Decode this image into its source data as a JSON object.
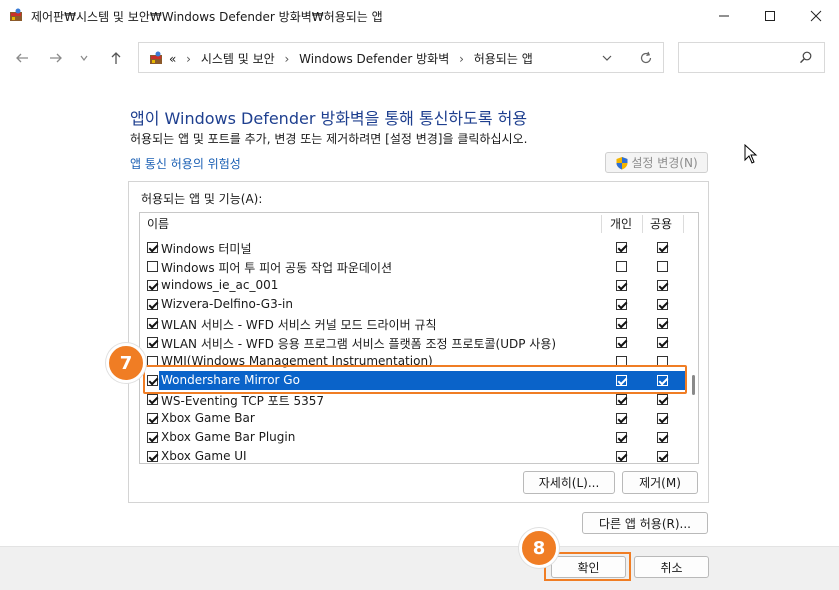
{
  "window": {
    "title": "제어판₩시스템 및 보안₩Windows Defender 방화벽₩허용되는 앱",
    "minimize_icon": "minimize-icon",
    "maximize_icon": "maximize-icon",
    "close_icon": "close-icon"
  },
  "navigation": {
    "back_icon": "arrow-left-icon",
    "forward_icon": "arrow-right-icon",
    "recent_icon": "chevron-down-icon",
    "up_icon": "arrow-up-icon",
    "breadcrumb_prefix": "«",
    "breadcrumb": [
      "시스템 및 보안",
      "Windows Defender 방화벽",
      "허용되는 앱"
    ],
    "breadcrumb_sep": "›",
    "search_placeholder": ""
  },
  "content": {
    "heading": "앱이 Windows Defender 방화벽을 통해 통신하도록 허용",
    "description": "허용되는 앱 및 포트를 추가, 변경 또는 제거하려면 [설정 변경]을 클릭하십시오.",
    "risk_link": "앱 통신 허용의 위험성",
    "change_settings_label": "설정 변경(N)",
    "group_label": "허용되는 앱 및 기능(A):",
    "columns": {
      "name": "이름",
      "private": "개인",
      "public": "공용"
    },
    "apps": [
      {
        "enabled": true,
        "name": "Windows 터미널",
        "private": true,
        "public": true
      },
      {
        "enabled": false,
        "name": "Windows 피어 투 피어 공동 작업 파운데이션",
        "private": false,
        "public": false
      },
      {
        "enabled": true,
        "name": "windows_ie_ac_001",
        "private": true,
        "public": true
      },
      {
        "enabled": true,
        "name": "Wizvera-Delfino-G3-in",
        "private": true,
        "public": true
      },
      {
        "enabled": true,
        "name": "WLAN 서비스 - WFD 서비스 커널 모드 드라이버 규칙",
        "private": true,
        "public": true
      },
      {
        "enabled": true,
        "name": "WLAN 서비스 - WFD 응용 프로그램 서비스 플랫폼 조정 프로토콜(UDP 사용)",
        "private": true,
        "public": true
      },
      {
        "enabled": false,
        "name": "WMI(Windows Management Instrumentation)",
        "private": false,
        "public": false
      },
      {
        "enabled": true,
        "name": "Wondershare Mirror Go",
        "private": true,
        "public": true,
        "selected": true
      },
      {
        "enabled": true,
        "name": "WS-Eventing TCP 포트 5357",
        "private": true,
        "public": true
      },
      {
        "enabled": true,
        "name": "Xbox Game Bar",
        "private": true,
        "public": true
      },
      {
        "enabled": true,
        "name": "Xbox Game Bar Plugin",
        "private": true,
        "public": true
      },
      {
        "enabled": true,
        "name": "Xbox Game UI",
        "private": true,
        "public": true
      }
    ],
    "details_label": "자세히(L)...",
    "remove_label": "제거(M)",
    "allow_other_label": "다른 앱 허용(R)..."
  },
  "footer": {
    "ok_label": "확인",
    "cancel_label": "취소"
  },
  "annotations": {
    "step7": "7",
    "step8": "8",
    "accent_color": "#f07d24"
  }
}
